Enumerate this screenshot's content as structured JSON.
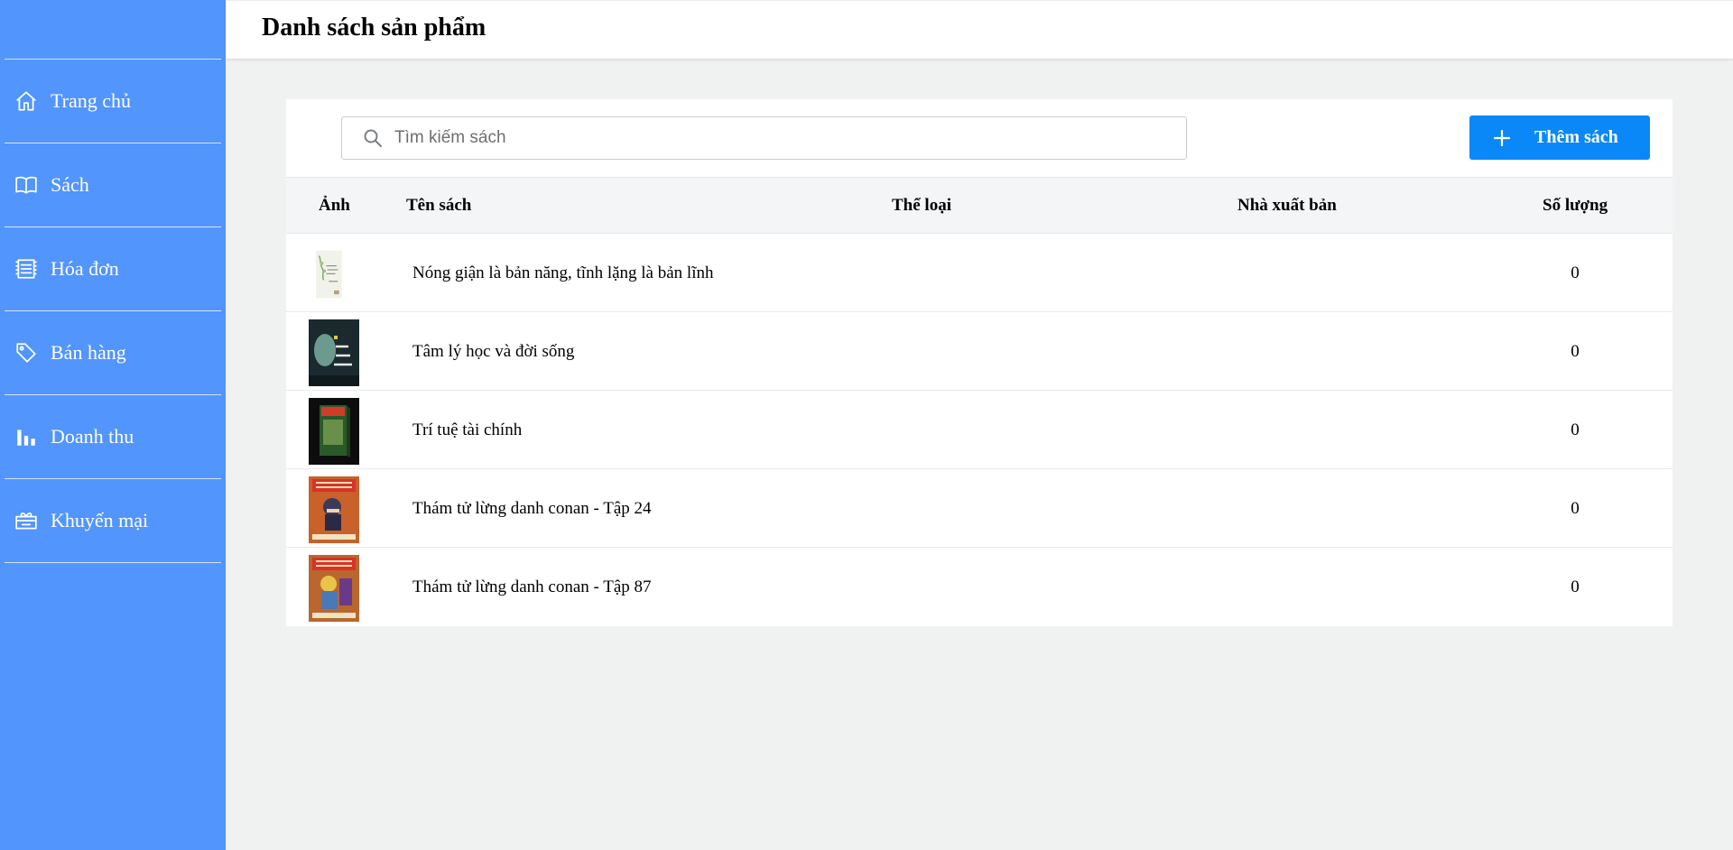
{
  "sidebar": {
    "items": [
      {
        "label": "Trang chủ",
        "icon": "home-icon"
      },
      {
        "label": "Sách",
        "icon": "book-icon"
      },
      {
        "label": "Hóa đơn",
        "icon": "receipt-icon"
      },
      {
        "label": "Bán hàng",
        "icon": "tag-icon"
      },
      {
        "label": "Doanh thu",
        "icon": "bar-chart-icon"
      },
      {
        "label": "Khuyến mại",
        "icon": "gift-icon"
      }
    ],
    "color": "#5295fc"
  },
  "header": {
    "title": "Danh sách sản phẩm"
  },
  "toolbar": {
    "search_placeholder": "Tìm kiếm sách",
    "search_value": "",
    "add_label": "Thêm sách",
    "add_color": "#0a88f7"
  },
  "table": {
    "columns": [
      "Ảnh",
      "Tên sách",
      "Thể loại",
      "Nhà xuất bản",
      "Số lượng"
    ],
    "rows": [
      {
        "name": "Nóng giận là bản năng, tĩnh lặng là bản lĩnh",
        "category": "",
        "publisher": "",
        "quantity": "0"
      },
      {
        "name": "Tâm lý học và đời sống",
        "category": "",
        "publisher": "",
        "quantity": "0"
      },
      {
        "name": "Trí tuệ tài chính",
        "category": "",
        "publisher": "",
        "quantity": "0"
      },
      {
        "name": "Thám tử lừng danh conan - Tập 24",
        "category": "",
        "publisher": "",
        "quantity": "0"
      },
      {
        "name": "Thám tử lừng danh conan - Tập 87",
        "category": "",
        "publisher": "",
        "quantity": "0"
      }
    ]
  }
}
